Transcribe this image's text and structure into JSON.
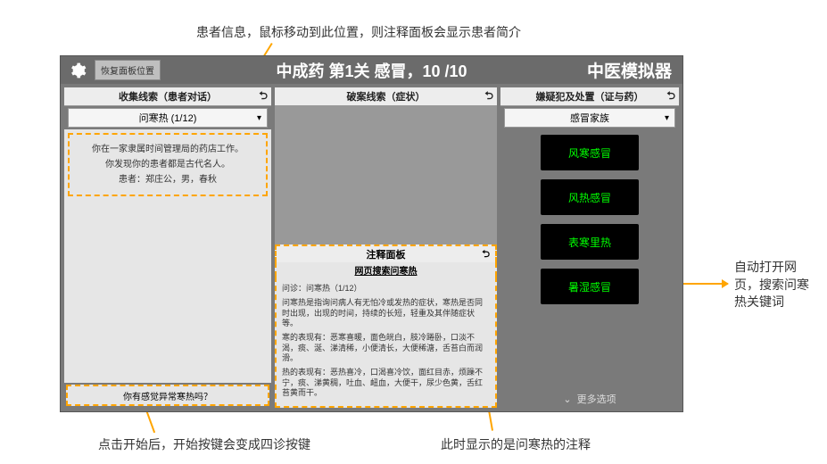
{
  "annotations": {
    "top": "患者信息，鼠标移动到此位置，则注释面板会显示患者简介",
    "bottom_left": "点击开始后，开始按键会变成四诊按键",
    "bottom_mid": "此时显示的是问寒热的注释",
    "right": "自动打开网页，搜索问寒热关键词"
  },
  "titlebar": {
    "restore_button": "恢复面板位置",
    "center": "中成药  第1关  感冒，10 /10",
    "right": "中医模拟器"
  },
  "panel_left": {
    "header": "收集线索（患者对话）",
    "dropdown": "问寒热 (1/12)",
    "dialog_line1": "你在一家隶属时间管理局的药店工作。",
    "dialog_line2": "你发现你的患者都是古代名人。",
    "dialog_line3": "患者：郑庄公，男，春秋",
    "start_bar": "你有感觉异常寒热吗？"
  },
  "panel_mid": {
    "header": "破案线索（症状）",
    "anno_header": "注释面板",
    "anno_subheader": "网页搜索问寒热",
    "anno_q": "问诊：问寒热（1/12）",
    "anno_p1": "问寒热是指询问病人有无怕冷或发热的症状，寒热是否同时出现，出现的时间，持续的长短，轻重及其伴随症状等。",
    "anno_p2": "寒的表现有：恶寒喜暖，面色㿠白，肢冷踡卧，口淡不渴，痰、涎、涕清稀，小便清长，大便稀溏，舌苔白而润滑。",
    "anno_p3": "热的表现有：恶热喜冷，口渴喜冷饮，面红目赤，烦躁不宁，痰、涕黄稠，吐血、衄血，大便干，尿少色黄，舌红苔黄而干。"
  },
  "panel_right": {
    "header": "嫌疑犯及处置（证与药）",
    "dropdown": "感冒家族",
    "pills": [
      "风寒感冒",
      "风热感冒",
      "表寒里热",
      "暑湿感冒"
    ],
    "more": "更多选项"
  }
}
